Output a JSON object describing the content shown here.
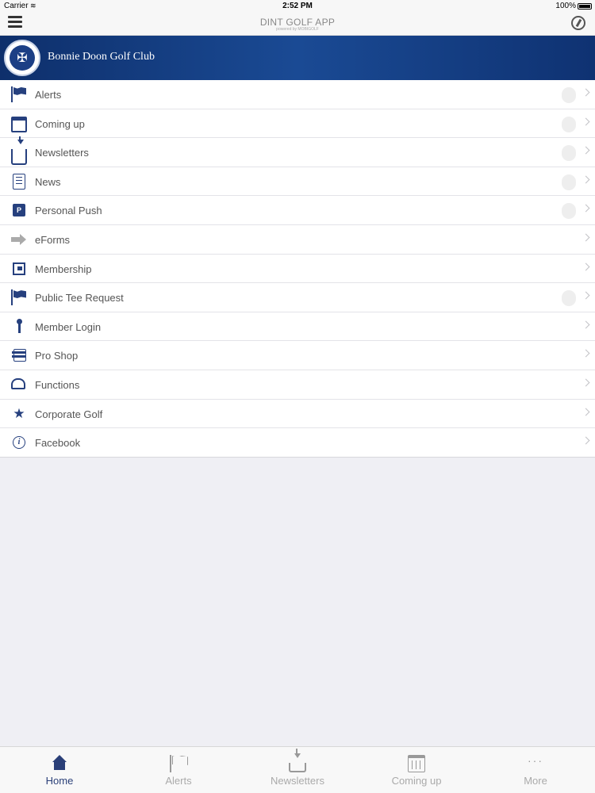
{
  "status_bar": {
    "carrier": "Carrier",
    "time": "2:52 PM",
    "battery": "100%"
  },
  "nav": {
    "title": "DINT GOLF APP",
    "subtitle": "powered by MOBIGOLF"
  },
  "club": {
    "name": "Bonnie Doon Golf Club"
  },
  "menu": {
    "items": [
      {
        "label": "Alerts",
        "icon": "flag-icon",
        "has_toggle": true
      },
      {
        "label": "Coming up",
        "icon": "calendar-icon",
        "has_toggle": true
      },
      {
        "label": "Newsletters",
        "icon": "inbox-download-icon",
        "has_toggle": true
      },
      {
        "label": "News",
        "icon": "document-icon",
        "has_toggle": true
      },
      {
        "label": "Personal Push",
        "icon": "pp-icon",
        "has_toggle": true
      },
      {
        "label": "eForms",
        "icon": "arrow-right-icon",
        "has_toggle": false
      },
      {
        "label": "Membership",
        "icon": "membership-icon",
        "has_toggle": false
      },
      {
        "label": "Public Tee Request",
        "icon": "flag-icon",
        "has_toggle": true
      },
      {
        "label": "Member Login",
        "icon": "key-icon",
        "has_toggle": false
      },
      {
        "label": "Pro Shop",
        "icon": "card-icon",
        "has_toggle": false
      },
      {
        "label": "Functions",
        "icon": "chef-hat-icon",
        "has_toggle": false
      },
      {
        "label": "Corporate Golf",
        "icon": "star-icon",
        "has_toggle": false
      },
      {
        "label": "Facebook",
        "icon": "info-icon",
        "has_toggle": false
      }
    ]
  },
  "tabs": [
    {
      "label": "Home",
      "icon": "home-icon",
      "active": true
    },
    {
      "label": "Alerts",
      "icon": "flag-icon",
      "active": false
    },
    {
      "label": "Newsletters",
      "icon": "inbox-download-icon",
      "active": false
    },
    {
      "label": "Coming up",
      "icon": "calendar-icon",
      "active": false
    },
    {
      "label": "More",
      "icon": "more-dots-icon",
      "active": false
    }
  ],
  "colors": {
    "brand_navy": "#1a4a94",
    "icon_blue": "#26407e",
    "background": "#efeff4"
  }
}
